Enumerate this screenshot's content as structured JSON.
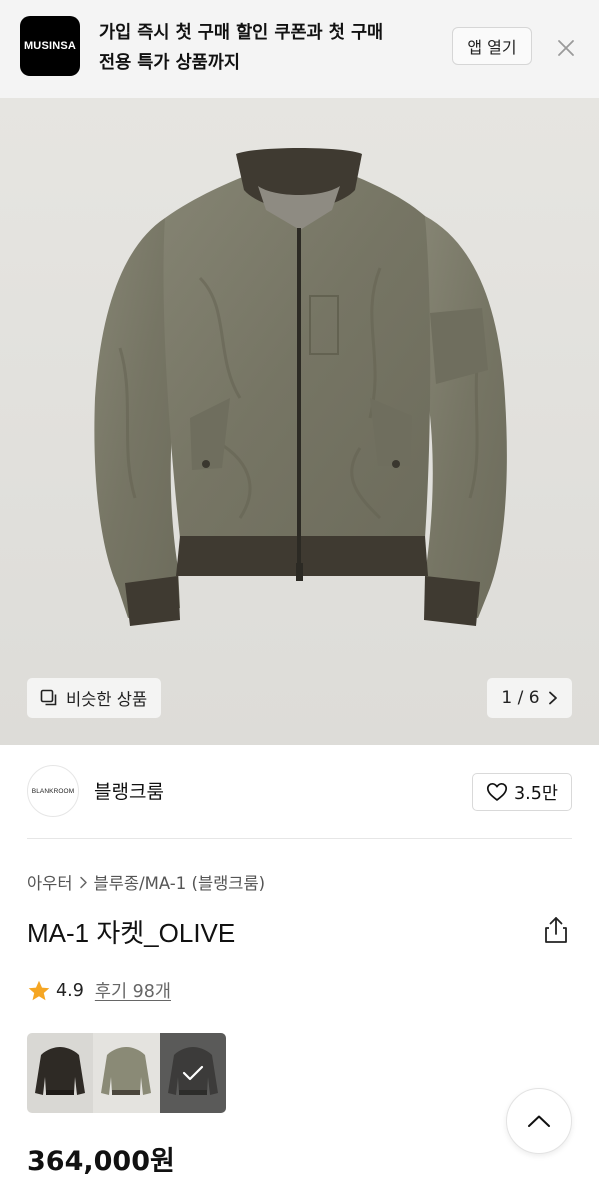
{
  "banner": {
    "logo_text": "MUSINSA",
    "message": "가입 즉시 첫 구매 할인 쿠폰과 첫 구매 전용 특가 상품까지",
    "message_line1": "가입 즉시 첫 구매 할인 쿠폰과 첫 구매",
    "message_line2": "전용 특가 상품까지",
    "open_app_label": "앱 열기",
    "close_icon": "close-icon"
  },
  "gallery": {
    "similar_label": "비슷한 상품",
    "similar_icon": "copy-icon",
    "current_page": "1",
    "total_pages": "6",
    "pager_separator": "/",
    "next_icon": "chevron-right-icon"
  },
  "brand": {
    "logo_text": "BLANKROOM",
    "name": "블랭크룸",
    "like_count": "3.5만",
    "like_icon": "heart-outline-icon"
  },
  "breadcrumb": {
    "category": "아우터",
    "subcategory": "블루종/MA-1 (블랭크룸)"
  },
  "product": {
    "title": "MA-1 자켓_OLIVE",
    "rating": "4.9",
    "reviews_label": "후기 98개",
    "price": "364,000원",
    "colors": {
      "accent_star": "#F5A623",
      "jacket_olive": "#7a7a66",
      "rib_brown": "#3f3a31"
    }
  },
  "swatches": [
    {
      "name": "black",
      "selected": false
    },
    {
      "name": "olive",
      "selected": false
    },
    {
      "name": "charcoal",
      "selected": true
    }
  ]
}
